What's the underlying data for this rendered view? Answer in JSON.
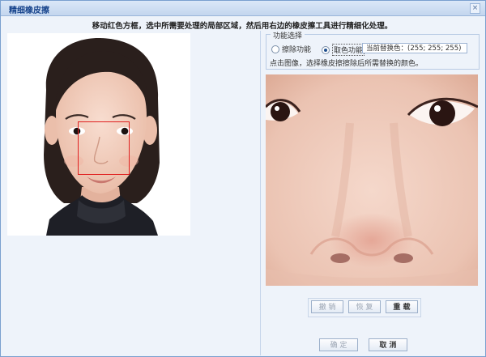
{
  "window": {
    "title": "精细橡皮擦",
    "close_glyph": "×"
  },
  "instruction": "移动红色方框，选中所需要处理的局部区域，然后用右边的橡皮擦工具进行精细化处理。",
  "function_panel": {
    "legend": "功能选择",
    "options": [
      {
        "label": "擦除功能",
        "selected": false
      },
      {
        "label": "取色功能",
        "selected": true
      }
    ],
    "color_field_value": "当前替换色：(255; 255; 255)",
    "hint": "点击图像，选择橡皮擦擦除后所需替换的颜色。"
  },
  "edit_buttons": [
    {
      "label": "撤 销",
      "enabled": false
    },
    {
      "label": "恢 复",
      "enabled": false
    },
    {
      "label": "重 载",
      "enabled": true
    }
  ],
  "dialog_buttons": [
    {
      "label": "确 定",
      "enabled": false
    },
    {
      "label": "取 消",
      "enabled": true
    }
  ],
  "colors": {
    "title_text": "#15428b",
    "selection_box": "#e02020",
    "window_bg": "#eef3fa"
  }
}
